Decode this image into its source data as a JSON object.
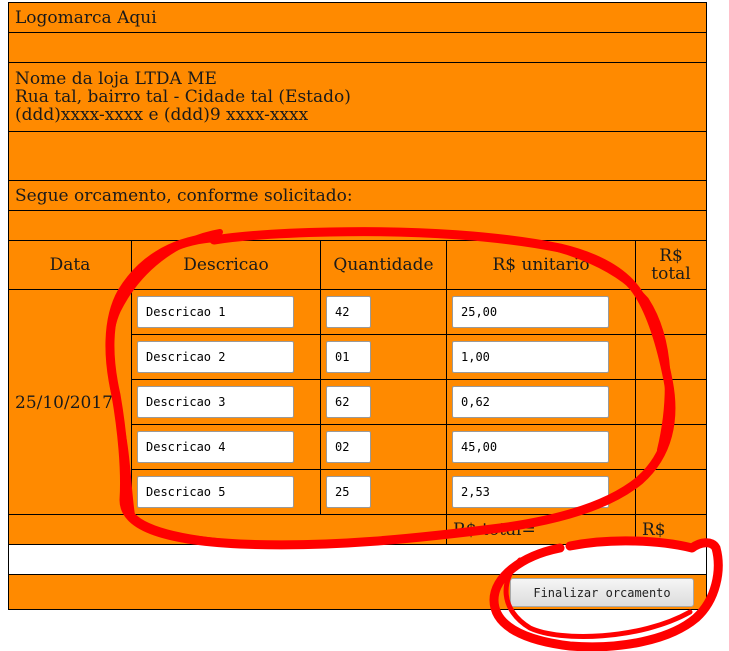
{
  "header": {
    "logo_text": "Logomarca Aqui",
    "store_name": "Nome da loja LTDA ME",
    "store_address": "Rua tal, bairro tal - Cidade tal (Estado)",
    "store_phones": "(ddd)xxxx-xxxx e (ddd)9 xxxx-xxxx",
    "intro": "Segue orcamento, conforme solicitado:"
  },
  "table": {
    "columns": [
      "Data",
      "Descricao",
      "Quantidade",
      "R$ unitario",
      "R$ total"
    ],
    "date": "25/10/2017",
    "items": [
      {
        "descricao": "Descricao 1",
        "quantidade": "42",
        "unitario": "25,00"
      },
      {
        "descricao": "Descricao 2",
        "quantidade": "01",
        "unitario": "1,00"
      },
      {
        "descricao": "Descricao 3",
        "quantidade": "62",
        "unitario": "0,62"
      },
      {
        "descricao": "Descricao 4",
        "quantidade": "02",
        "unitario": "45,00"
      },
      {
        "descricao": "Descricao 5",
        "quantidade": "25",
        "unitario": "2,53"
      }
    ],
    "total_label": "R$ total=",
    "total_value": "R$"
  },
  "actions": {
    "finalize_label": "Finalizar orcamento"
  },
  "colors": {
    "background_orange": "#ff8a00",
    "annotation_red": "#ff0000"
  }
}
